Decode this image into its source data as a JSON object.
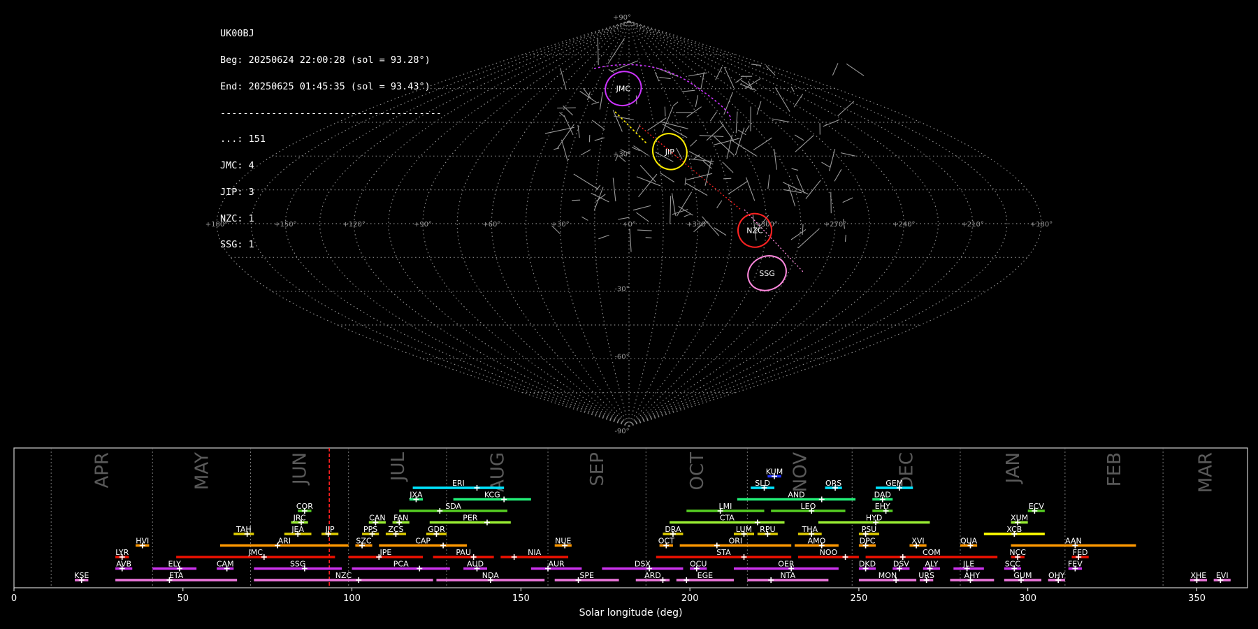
{
  "info": {
    "station": "UK00BJ",
    "begin": "Beg: 20250624 22:00:28 (sol = 93.28°)",
    "end": "End: 20250625 01:45:35 (sol = 93.43°)",
    "separator": "---------------------------------------",
    "counts": [
      {
        "label": "...: 151"
      },
      {
        "label": "JMC: 4"
      },
      {
        "label": "JIP: 3"
      },
      {
        "label": "NZC: 1"
      },
      {
        "label": "SSG: 1"
      }
    ]
  },
  "sky_map": {
    "projection": "sinusoidal",
    "lon_labels": [
      "+180°",
      "+150°",
      "+120°",
      "+90°",
      "+60°",
      "+30°",
      "+0°",
      "+330°",
      "+300°",
      "+270°",
      "+240°",
      "+210°",
      "+180°"
    ],
    "lat_labels": [
      "+90°",
      "+30°",
      "-30°",
      "-60°",
      "-90°"
    ],
    "radiants": [
      {
        "name": "JMC",
        "color": "#cc33ff",
        "lon": 5,
        "lat": 60,
        "rx": 26,
        "ry": 24
      },
      {
        "name": "JIP",
        "color": "#ffee00",
        "lon": 339,
        "lat": 32,
        "rx": 24,
        "ry": 26
      },
      {
        "name": "NZC",
        "color": "#ff2222",
        "lon": 305,
        "lat": -3,
        "rx": 24,
        "ry": 24
      },
      {
        "name": "SSG",
        "color": "#ff88dd",
        "lon": 295,
        "lat": -22,
        "rx": 28,
        "ry": 24
      }
    ]
  },
  "chart_data": {
    "type": "timeline",
    "xlabel": "Solar longitude (deg)",
    "xlim": [
      0,
      365
    ],
    "xticks": [
      0,
      50,
      100,
      150,
      200,
      250,
      300,
      350
    ],
    "current_sol": 93.3,
    "months": [
      {
        "label": "APR",
        "start": 11,
        "end": 41
      },
      {
        "label": "MAY",
        "start": 41,
        "end": 70
      },
      {
        "label": "JUN",
        "start": 70,
        "end": 99
      },
      {
        "label": "JUL",
        "start": 99,
        "end": 128
      },
      {
        "label": "AUG",
        "start": 128,
        "end": 158
      },
      {
        "label": "SEP",
        "start": 158,
        "end": 187
      },
      {
        "label": "OCT",
        "start": 187,
        "end": 217
      },
      {
        "label": "NOV",
        "start": 217,
        "end": 248
      },
      {
        "label": "DEC",
        "start": 248,
        "end": 280
      },
      {
        "label": "JAN",
        "start": 280,
        "end": 311
      },
      {
        "label": "FEB",
        "start": 311,
        "end": 340
      },
      {
        "label": "MAR",
        "start": 340,
        "end": 365
      }
    ],
    "showers": [
      {
        "name": "KUM",
        "start": 223,
        "end": 227,
        "peak": 225,
        "row": 10,
        "color": "#2233ff"
      },
      {
        "name": "ERI",
        "start": 118,
        "end": 145,
        "peak": 137,
        "row": 9,
        "color": "#00e5ff"
      },
      {
        "name": "SLD",
        "start": 218,
        "end": 225,
        "peak": 222,
        "row": 9,
        "color": "#00e5ff"
      },
      {
        "name": "ORS",
        "start": 240,
        "end": 245,
        "peak": 243,
        "row": 9,
        "color": "#00e5ff"
      },
      {
        "name": "GEM",
        "start": 255,
        "end": 266,
        "peak": 262,
        "row": 9,
        "color": "#00e5ff"
      },
      {
        "name": "JXA",
        "start": 117,
        "end": 121,
        "peak": 119,
        "row": 8,
        "color": "#22ee77"
      },
      {
        "name": "KCG",
        "start": 130,
        "end": 153,
        "peak": 145,
        "row": 8,
        "color": "#22ee77"
      },
      {
        "name": "AND",
        "start": 214,
        "end": 249,
        "peak": 239,
        "row": 8,
        "color": "#22ee77"
      },
      {
        "name": "DAD",
        "start": 254,
        "end": 260,
        "peak": 257,
        "row": 8,
        "color": "#22ee77"
      },
      {
        "name": "COR",
        "start": 84,
        "end": 88,
        "peak": 86,
        "row": 7,
        "color": "#55cc22"
      },
      {
        "name": "SDA",
        "start": 114,
        "end": 146,
        "peak": 126,
        "row": 7,
        "color": "#55cc22"
      },
      {
        "name": "LMI",
        "start": 199,
        "end": 222,
        "peak": 209,
        "row": 7,
        "color": "#55cc22"
      },
      {
        "name": "LEO",
        "start": 224,
        "end": 246,
        "peak": 236,
        "row": 7,
        "color": "#55cc22"
      },
      {
        "name": "EHY",
        "start": 254,
        "end": 260,
        "peak": 258,
        "row": 7,
        "color": "#55cc22"
      },
      {
        "name": "ECV",
        "start": 300,
        "end": 305,
        "peak": 302,
        "row": 7,
        "color": "#55cc22"
      },
      {
        "name": "JRC",
        "start": 82,
        "end": 87,
        "peak": 85,
        "row": 6,
        "color": "#99ee33"
      },
      {
        "name": "CAN",
        "start": 105,
        "end": 110,
        "peak": 107,
        "row": 6,
        "color": "#99ee33"
      },
      {
        "name": "FAN",
        "start": 112,
        "end": 117,
        "peak": 114,
        "row": 6,
        "color": "#99ee33"
      },
      {
        "name": "PER",
        "start": 123,
        "end": 147,
        "peak": 140,
        "row": 6,
        "color": "#99ee33"
      },
      {
        "name": "CTA",
        "start": 194,
        "end": 228,
        "peak": 220,
        "row": 6,
        "color": "#99ee33"
      },
      {
        "name": "HYD",
        "start": 238,
        "end": 271,
        "peak": 255,
        "row": 6,
        "color": "#99ee33"
      },
      {
        "name": "XUM",
        "start": 295,
        "end": 300,
        "peak": 297,
        "row": 6,
        "color": "#99ee33"
      },
      {
        "name": "TAH",
        "start": 65,
        "end": 71,
        "peak": 69,
        "row": 5,
        "color": "#ddcc00"
      },
      {
        "name": "JEA",
        "start": 80,
        "end": 88,
        "peak": 84,
        "row": 5,
        "color": "#ddcc00"
      },
      {
        "name": "JIP",
        "start": 91,
        "end": 96,
        "peak": 93,
        "row": 5,
        "color": "#ddcc00"
      },
      {
        "name": "PPS",
        "start": 103,
        "end": 108,
        "peak": 106,
        "row": 5,
        "color": "#ddcc00"
      },
      {
        "name": "ZCS",
        "start": 110,
        "end": 116,
        "peak": 113,
        "row": 5,
        "color": "#ddcc00"
      },
      {
        "name": "GDR",
        "start": 122,
        "end": 128,
        "peak": 125,
        "row": 5,
        "color": "#ddcc00"
      },
      {
        "name": "DRA",
        "start": 192,
        "end": 198,
        "peak": 195,
        "row": 5,
        "color": "#ddcc00"
      },
      {
        "name": "LUM",
        "start": 213,
        "end": 219,
        "peak": 216,
        "row": 5,
        "color": "#ddcc00"
      },
      {
        "name": "RPU",
        "start": 220,
        "end": 226,
        "peak": 223,
        "row": 5,
        "color": "#ddcc00"
      },
      {
        "name": "THA",
        "start": 232,
        "end": 239,
        "peak": 236,
        "row": 5,
        "color": "#ddcc00"
      },
      {
        "name": "PSU",
        "start": 250,
        "end": 256,
        "peak": 252,
        "row": 5,
        "color": "#ddcc00"
      },
      {
        "name": "XCB",
        "start": 287,
        "end": 305,
        "peak": 296,
        "row": 5,
        "color": "#ffff00"
      },
      {
        "name": "HVI",
        "start": 36,
        "end": 40,
        "peak": 38,
        "row": 4,
        "color": "#ff9900"
      },
      {
        "name": "ARI",
        "start": 61,
        "end": 99,
        "peak": 78,
        "row": 4,
        "color": "#ff9900"
      },
      {
        "name": "SZC",
        "start": 101,
        "end": 106,
        "peak": 103,
        "row": 4,
        "color": "#ff9900"
      },
      {
        "name": "CAP",
        "start": 108,
        "end": 134,
        "peak": 127,
        "row": 4,
        "color": "#ff9900"
      },
      {
        "name": "NUE",
        "start": 160,
        "end": 165,
        "peak": 163,
        "row": 4,
        "color": "#ff9900"
      },
      {
        "name": "OCT",
        "start": 191,
        "end": 195,
        "peak": 193,
        "row": 4,
        "color": "#ff9900"
      },
      {
        "name": "ORI",
        "start": 197,
        "end": 230,
        "peak": 208,
        "row": 4,
        "color": "#ff9900"
      },
      {
        "name": "AMO",
        "start": 231,
        "end": 244,
        "peak": 239,
        "row": 4,
        "color": "#ff9900"
      },
      {
        "name": "DPC",
        "start": 250,
        "end": 255,
        "peak": 252,
        "row": 4,
        "color": "#ff9900"
      },
      {
        "name": "XVI",
        "start": 265,
        "end": 270,
        "peak": 267,
        "row": 4,
        "color": "#ff9900"
      },
      {
        "name": "QUA",
        "start": 280,
        "end": 285,
        "peak": 283,
        "row": 4,
        "color": "#ff9900"
      },
      {
        "name": "AAN",
        "start": 295,
        "end": 332,
        "peak": 314,
        "row": 4,
        "color": "#ff9900"
      },
      {
        "name": "LYR",
        "start": 30,
        "end": 34,
        "peak": 32,
        "row": 3,
        "color": "#ee1100"
      },
      {
        "name": "JMC",
        "start": 48,
        "end": 95,
        "peak": 74,
        "row": 3,
        "color": "#ee1100"
      },
      {
        "name": "JPE",
        "start": 99,
        "end": 121,
        "peak": 108,
        "row": 3,
        "color": "#ee1100"
      },
      {
        "name": "PAU",
        "start": 124,
        "end": 142,
        "peak": 136,
        "row": 3,
        "color": "#ee1100"
      },
      {
        "name": "NIA",
        "start": 144,
        "end": 164,
        "peak": 148,
        "row": 3,
        "color": "#ee1100"
      },
      {
        "name": "STA",
        "start": 190,
        "end": 230,
        "peak": 216,
        "row": 3,
        "color": "#ee1100"
      },
      {
        "name": "NOO",
        "start": 232,
        "end": 250,
        "peak": 246,
        "row": 3,
        "color": "#ee1100"
      },
      {
        "name": "COM",
        "start": 252,
        "end": 291,
        "peak": 263,
        "row": 3,
        "color": "#ee1100"
      },
      {
        "name": "NCC",
        "start": 295,
        "end": 299,
        "peak": 297,
        "row": 3,
        "color": "#ee1100"
      },
      {
        "name": "FED",
        "start": 313,
        "end": 318,
        "peak": 315,
        "row": 3,
        "color": "#ee1100"
      },
      {
        "name": "AVB",
        "start": 30,
        "end": 35,
        "peak": 32,
        "row": 2,
        "color": "#cc33ee"
      },
      {
        "name": "ELY",
        "start": 41,
        "end": 54,
        "peak": 49,
        "row": 2,
        "color": "#cc33ee"
      },
      {
        "name": "CAM",
        "start": 60,
        "end": 65,
        "peak": 63,
        "row": 2,
        "color": "#cc33ee"
      },
      {
        "name": "SSG",
        "start": 71,
        "end": 97,
        "peak": 86,
        "row": 2,
        "color": "#cc33ee"
      },
      {
        "name": "PCA",
        "start": 100,
        "end": 129,
        "peak": 120,
        "row": 2,
        "color": "#cc33ee"
      },
      {
        "name": "AUD",
        "start": 133,
        "end": 140,
        "peak": 137,
        "row": 2,
        "color": "#cc33ee"
      },
      {
        "name": "AUR",
        "start": 153,
        "end": 168,
        "peak": 158,
        "row": 2,
        "color": "#cc33ee"
      },
      {
        "name": "DSX",
        "start": 174,
        "end": 198,
        "peak": 188,
        "row": 2,
        "color": "#cc33ee"
      },
      {
        "name": "OCU",
        "start": 200,
        "end": 205,
        "peak": 202,
        "row": 2,
        "color": "#cc33ee"
      },
      {
        "name": "OER",
        "start": 213,
        "end": 244,
        "peak": 230,
        "row": 2,
        "color": "#cc33ee"
      },
      {
        "name": "DKD",
        "start": 250,
        "end": 255,
        "peak": 252,
        "row": 2,
        "color": "#cc33ee"
      },
      {
        "name": "DSV",
        "start": 260,
        "end": 265,
        "peak": 262,
        "row": 2,
        "color": "#cc33ee"
      },
      {
        "name": "ALY",
        "start": 269,
        "end": 274,
        "peak": 271,
        "row": 2,
        "color": "#cc33ee"
      },
      {
        "name": "JLE",
        "start": 278,
        "end": 287,
        "peak": 282,
        "row": 2,
        "color": "#cc33ee"
      },
      {
        "name": "SCC",
        "start": 293,
        "end": 298,
        "peak": 296,
        "row": 2,
        "color": "#cc33ee"
      },
      {
        "name": "FEV",
        "start": 312,
        "end": 316,
        "peak": 314,
        "row": 2,
        "color": "#cc33ee"
      },
      {
        "name": "KSE",
        "start": 18,
        "end": 22,
        "peak": 20,
        "row": 1,
        "color": "#ee77dd"
      },
      {
        "name": "ETA",
        "start": 30,
        "end": 66,
        "peak": 46,
        "row": 1,
        "color": "#ee77dd"
      },
      {
        "name": "NZC",
        "start": 71,
        "end": 124,
        "peak": 102,
        "row": 1,
        "color": "#ee77dd"
      },
      {
        "name": "NDA",
        "start": 125,
        "end": 157,
        "peak": 141,
        "row": 1,
        "color": "#ee77dd"
      },
      {
        "name": "SPE",
        "start": 160,
        "end": 179,
        "peak": 167,
        "row": 1,
        "color": "#ee77dd"
      },
      {
        "name": "ARD",
        "start": 184,
        "end": 194,
        "peak": 192,
        "row": 1,
        "color": "#ee77dd"
      },
      {
        "name": "EGE",
        "start": 196,
        "end": 213,
        "peak": 199,
        "row": 1,
        "color": "#ee77dd"
      },
      {
        "name": "NTA",
        "start": 217,
        "end": 241,
        "peak": 224,
        "row": 1,
        "color": "#ee77dd"
      },
      {
        "name": "MON",
        "start": 250,
        "end": 267,
        "peak": 261,
        "row": 1,
        "color": "#ee77dd"
      },
      {
        "name": "URS",
        "start": 268,
        "end": 272,
        "peak": 270,
        "row": 1,
        "color": "#ee77dd"
      },
      {
        "name": "AHY",
        "start": 277,
        "end": 290,
        "peak": 283,
        "row": 1,
        "color": "#ee77dd"
      },
      {
        "name": "GUM",
        "start": 293,
        "end": 304,
        "peak": 298,
        "row": 1,
        "color": "#ee77dd"
      },
      {
        "name": "OHY",
        "start": 306,
        "end": 311,
        "peak": 309,
        "row": 1,
        "color": "#ee77dd"
      },
      {
        "name": "XHE",
        "start": 348,
        "end": 353,
        "peak": 350,
        "row": 1,
        "color": "#ee77dd"
      },
      {
        "name": "EVI",
        "start": 355,
        "end": 360,
        "peak": 357,
        "row": 1,
        "color": "#ee77dd"
      }
    ]
  }
}
